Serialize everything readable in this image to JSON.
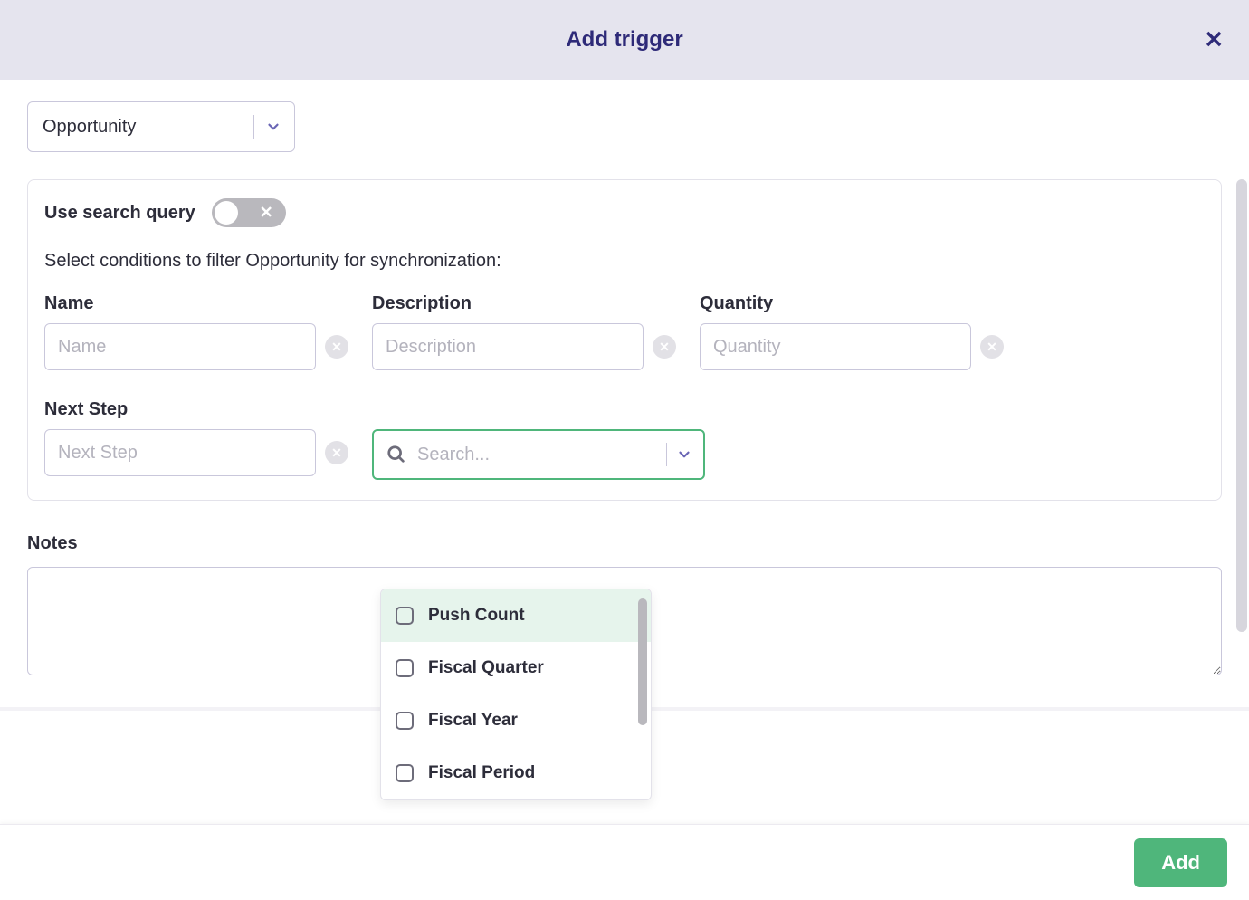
{
  "header": {
    "title": "Add trigger"
  },
  "entitySelect": {
    "value": "Opportunity"
  },
  "toggle": {
    "label": "Use search query",
    "on": false
  },
  "instruction": "Select conditions to filter Opportunity for synchronization:",
  "fields": {
    "name": {
      "label": "Name",
      "placeholder": "Name",
      "value": ""
    },
    "description": {
      "label": "Description",
      "placeholder": "Description",
      "value": ""
    },
    "quantity": {
      "label": "Quantity",
      "placeholder": "Quantity",
      "value": ""
    },
    "nextStep": {
      "label": "Next Step",
      "placeholder": "Next Step",
      "value": ""
    }
  },
  "searchDropdown": {
    "placeholder": "Search...",
    "options": [
      {
        "label": "Push Count",
        "checked": false
      },
      {
        "label": "Fiscal Quarter",
        "checked": false
      },
      {
        "label": "Fiscal Year",
        "checked": false
      },
      {
        "label": "Fiscal Period",
        "checked": false
      }
    ]
  },
  "notes": {
    "label": "Notes",
    "value": ""
  },
  "footer": {
    "addLabel": "Add"
  }
}
